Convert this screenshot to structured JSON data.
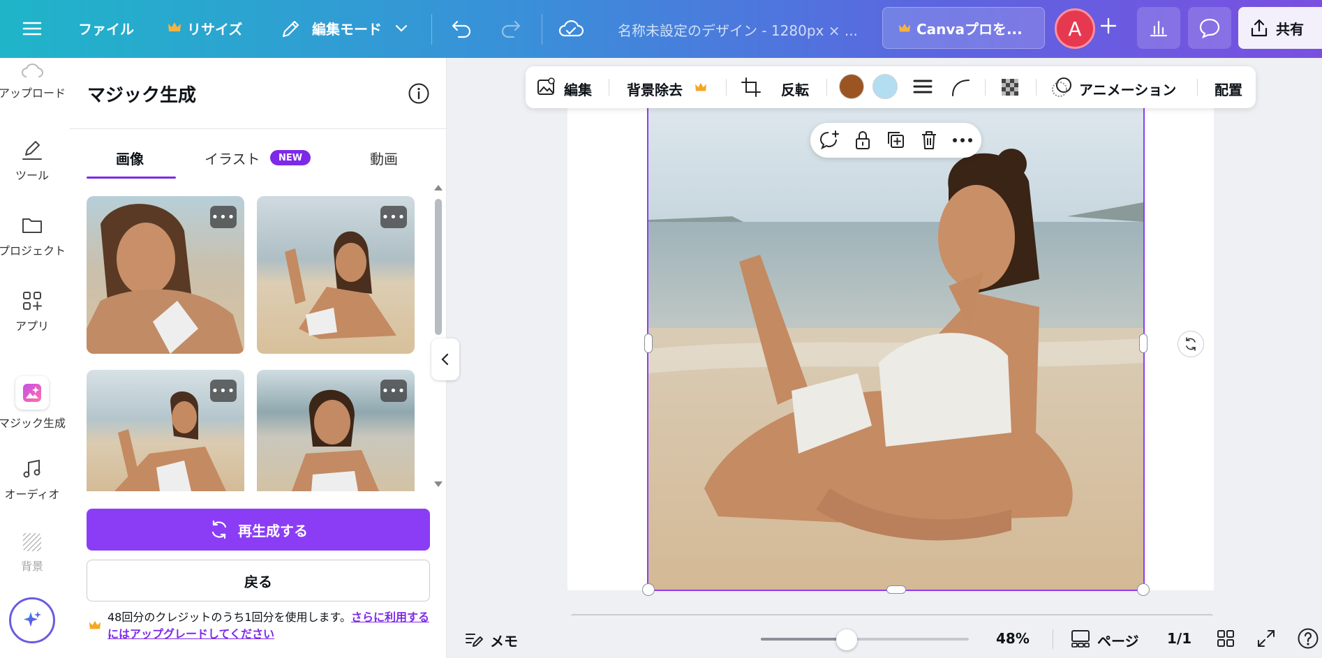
{
  "topbar": {
    "file_label": "ファイル",
    "resize_label": "リサイズ",
    "edit_mode_label": "編集モード",
    "title": "名称未設定のデザイン - 1280px × ...",
    "pro_label": "Canvaプロを...",
    "avatar_initial": "A",
    "share_label": "共有"
  },
  "rail": {
    "items": [
      {
        "label": "アップロード",
        "icon": "cloud-upload-icon"
      },
      {
        "label": "ツール",
        "icon": "pen-icon"
      },
      {
        "label": "プロジェクト",
        "icon": "folder-icon"
      },
      {
        "label": "アプリ",
        "icon": "apps-icon"
      },
      {
        "label": "マジック生成",
        "icon": "magic-media-icon"
      },
      {
        "label": "オーディオ",
        "icon": "music-note-icon"
      },
      {
        "label": "背景",
        "icon": "background-icon"
      }
    ]
  },
  "panel": {
    "title": "マジック生成",
    "tabs": [
      {
        "label": "画像",
        "active": true
      },
      {
        "label": "イラスト",
        "badge": "NEW"
      },
      {
        "label": "動画"
      }
    ],
    "more_label": "•••",
    "regenerate_label": "再生成する",
    "back_label": "戻る",
    "credit_text": "48回分のクレジットのうち1回分を使用します。",
    "credit_link": "さらに利用するにはアップグレードしてください"
  },
  "context_toolbar": {
    "edit_label": "編集",
    "bg_remove_label": "背景除去",
    "flip_label": "反転",
    "colors": [
      "#9b5523",
      "#b3def2"
    ],
    "animation_label": "アニメーション",
    "arrange_label": "配置"
  },
  "bottombar": {
    "notes_label": "メモ",
    "zoom": "48%",
    "pages_label": "ページ",
    "page_count": "1/1"
  },
  "colors": {
    "accent": "#7d2ae8",
    "button": "#8b3df6",
    "crown": "#f5a623"
  }
}
